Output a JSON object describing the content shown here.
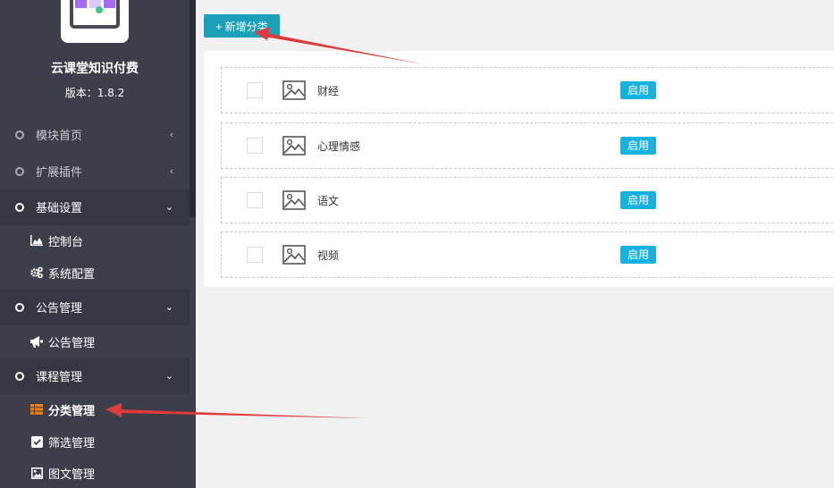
{
  "sidebar": {
    "title": "云课堂知识付费",
    "version": "版本：1.8.2",
    "menu": [
      {
        "label": "模块首页",
        "state": "collapsed"
      },
      {
        "label": "扩展插件",
        "state": "collapsed"
      },
      {
        "label": "基础设置",
        "state": "expanded"
      },
      {
        "label": "公告管理",
        "state": "expanded"
      },
      {
        "label": "课程管理",
        "state": "expanded"
      }
    ],
    "sub": {
      "dashboard": "控制台",
      "system_config": "系统配置",
      "notice_manage": "公告管理",
      "category_manage": "分类管理",
      "filter_manage": "筛选管理",
      "article_manage": "图文管理"
    },
    "active_color": "#ff7a00"
  },
  "toolbar": {
    "add_label": "+ 新增分类"
  },
  "categories": [
    {
      "name": "财经",
      "status": "启用"
    },
    {
      "name": "心理情感",
      "status": "启用"
    },
    {
      "name": "语文",
      "status": "启用"
    },
    {
      "name": "视频",
      "status": "启用"
    }
  ],
  "colors": {
    "sidebar_bg": "#3c3f4a",
    "button": "#1ca0b8",
    "badge": "#16b3e0",
    "annotation_arrow": "#e03b3b"
  }
}
